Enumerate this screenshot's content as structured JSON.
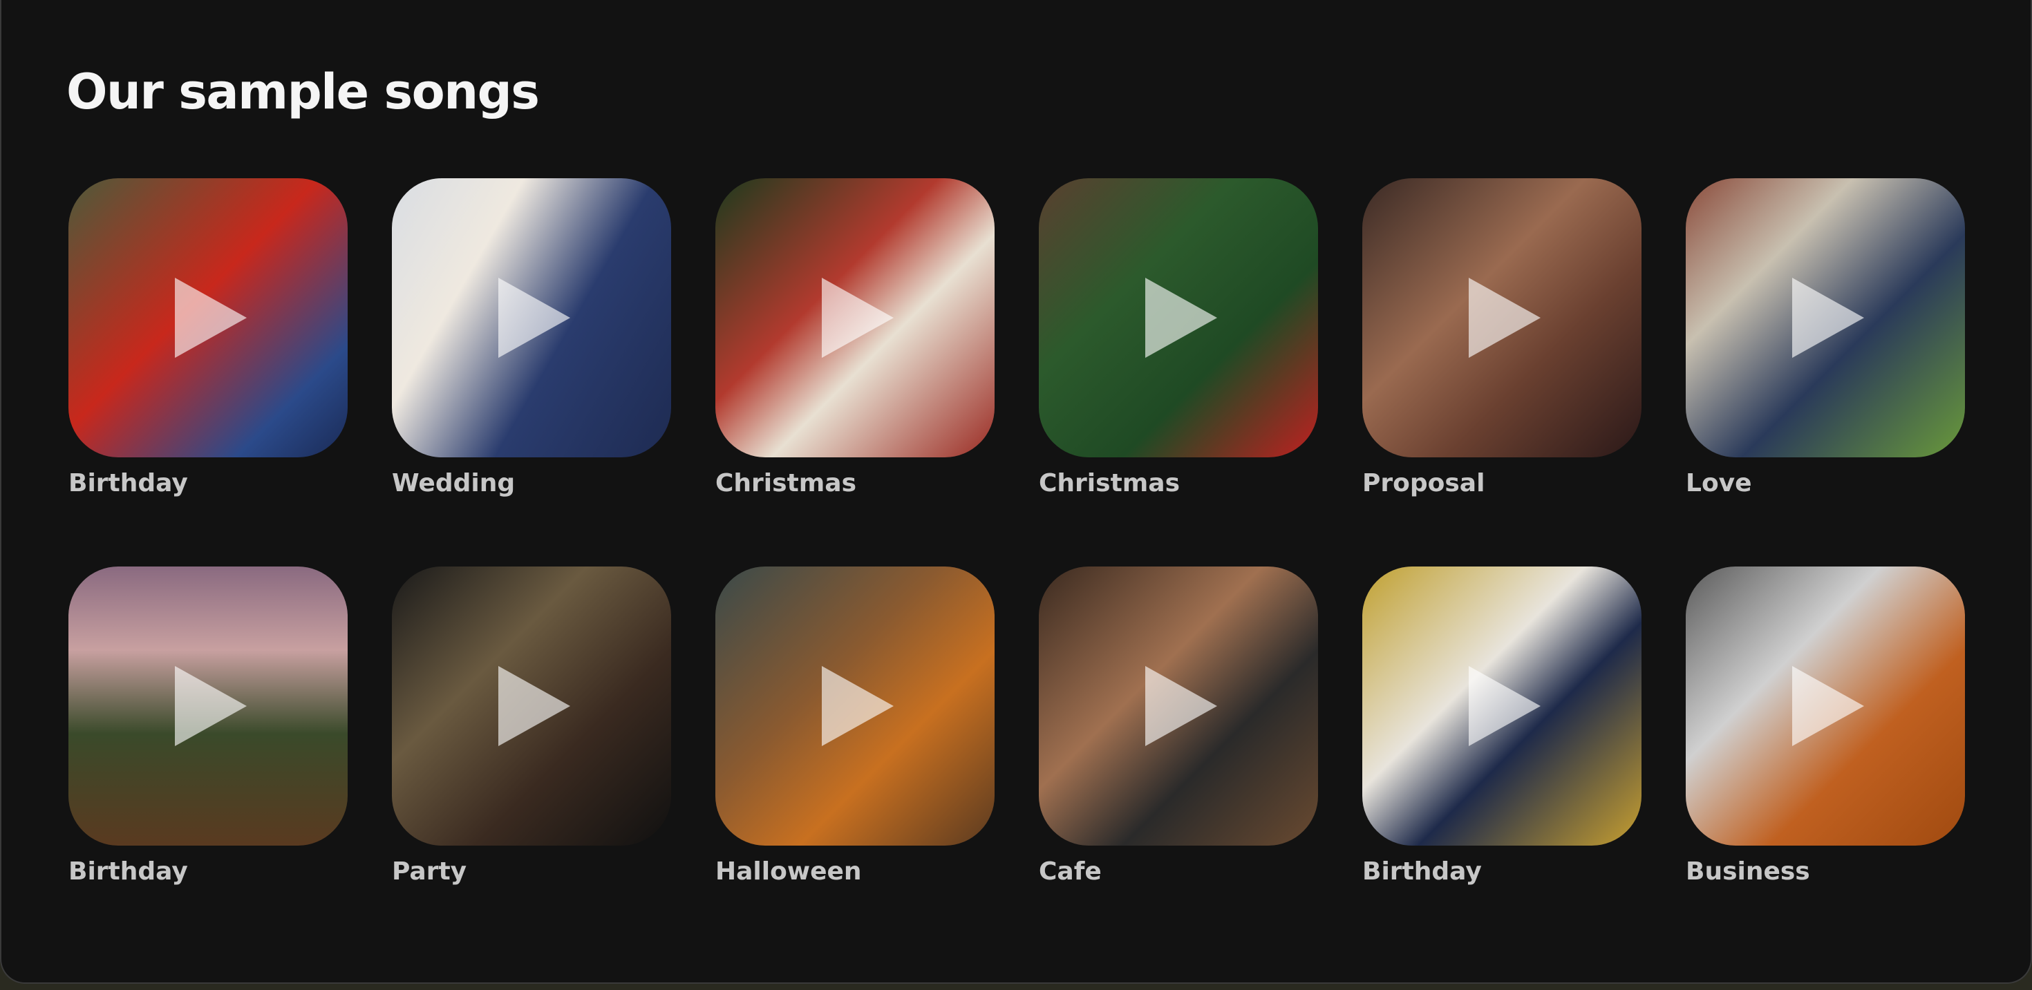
{
  "section": {
    "title": "Our sample songs"
  },
  "play_icon": "play-icon",
  "songs": [
    {
      "label": "Birthday",
      "bg": "linear-gradient(135deg, #4d5a3a 0%, #c8281c 45%, #2b4a8a 80%, #1a2a55 100%)"
    },
    {
      "label": "Wedding",
      "bg": "linear-gradient(120deg, #d9dde2 0%, #efe9e0 30%, #2a3c6e 60%, #1e2b52 100%)"
    },
    {
      "label": "Christmas",
      "bg": "linear-gradient(135deg, #1d3a1d 0%, #b23a2e 40%, #e8e0d2 60%, #9a2a22 100%)"
    },
    {
      "label": "Christmas",
      "bg": "linear-gradient(135deg, #5a4030 0%, #2c5a2c 35%, #1f4a24 65%, #c02020 100%)"
    },
    {
      "label": "Proposal",
      "bg": "linear-gradient(135deg, #3a2a25 0%, #9a6a50 40%, #6a4030 65%, #2a1818 100%)"
    },
    {
      "label": "Love",
      "bg": "linear-gradient(135deg, #8a4a3a 0%, #c8c0b0 30%, #2a3a5a 60%, #6a9a3a 100%)"
    },
    {
      "label": "Birthday",
      "bg": "linear-gradient(180deg, #8a6a80 0%, #c8a0a0 30%, #3a4a2a 60%, #5a3a20 100%)"
    },
    {
      "label": "Party",
      "bg": "linear-gradient(135deg, #1a1a1a 0%, #6a5a40 35%, #3a2a20 65%, #101010 100%)"
    },
    {
      "label": "Halloween",
      "bg": "linear-gradient(135deg, #3a4a4a 0%, #8a5a30 40%, #c87020 65%, #5a3a20 100%)"
    },
    {
      "label": "Cafe",
      "bg": "linear-gradient(135deg, #3a2a20 0%, #a07050 40%, #2a2a2a 65%, #6a4a30 100%)"
    },
    {
      "label": "Birthday",
      "bg": "linear-gradient(135deg, #c0a030 0%, #e8e4dc 40%, #1e2a4a 60%, #c8a030 100%)"
    },
    {
      "label": "Business",
      "bg": "linear-gradient(135deg, #5a5a5a 0%, #d0d0d0 35%, #c06020 65%, #a04a10 100%)"
    }
  ]
}
